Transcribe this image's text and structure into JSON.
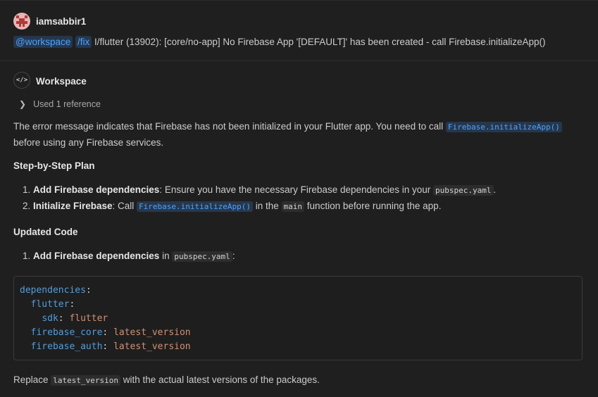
{
  "user": {
    "name": "iamsabbir1",
    "agent_chip": "@workspace",
    "command_chip": "/fix",
    "message": " I/flutter (13902): [core/no-app] No Firebase App '[DEFAULT]' has been created - call Firebase.initializeApp()"
  },
  "response": {
    "agent_name": "Workspace",
    "references_label": "Used 1 reference",
    "intro": {
      "before": "The error message indicates that Firebase has not been initialized in your Flutter app. You need to call ",
      "code": "Firebase.initializeApp()",
      "after": " before using any Firebase services."
    },
    "plan_heading": "Step-by-Step Plan",
    "plan": [
      {
        "bold": "Add Firebase dependencies",
        "text": ": Ensure you have the necessary Firebase dependencies in your ",
        "code": "pubspec.yaml",
        "after": "."
      },
      {
        "bold": "Initialize Firebase",
        "text": ": Call ",
        "code": "Firebase.initializeApp()",
        "mid": " in the ",
        "code2": "main",
        "after": " function before running the app."
      }
    ],
    "code_heading": "Updated Code",
    "code_step": {
      "bold": "Add Firebase dependencies",
      "text": " in ",
      "code": "pubspec.yaml",
      "after": ":"
    },
    "code_lines": [
      {
        "indent": "",
        "key": "dependencies",
        "value": ""
      },
      {
        "indent": "  ",
        "key": "flutter",
        "value": ""
      },
      {
        "indent": "    ",
        "key": "sdk",
        "value": "flutter"
      },
      {
        "indent": "  ",
        "key": "firebase_core",
        "value": "latest_version"
      },
      {
        "indent": "  ",
        "key": "firebase_auth",
        "value": "latest_version"
      }
    ],
    "replace": {
      "before": "Replace ",
      "code": "latest_version",
      "after": " with the actual latest versions of the packages."
    }
  },
  "colors": {
    "background": "#1f1f1f",
    "link": "#4da3ff",
    "yaml_key": "#569cd6",
    "yaml_value": "#ce9178"
  },
  "icons": {
    "avatar": "user-avatar",
    "agent": "code-brackets-icon",
    "chevron": "chevron-right-icon"
  }
}
